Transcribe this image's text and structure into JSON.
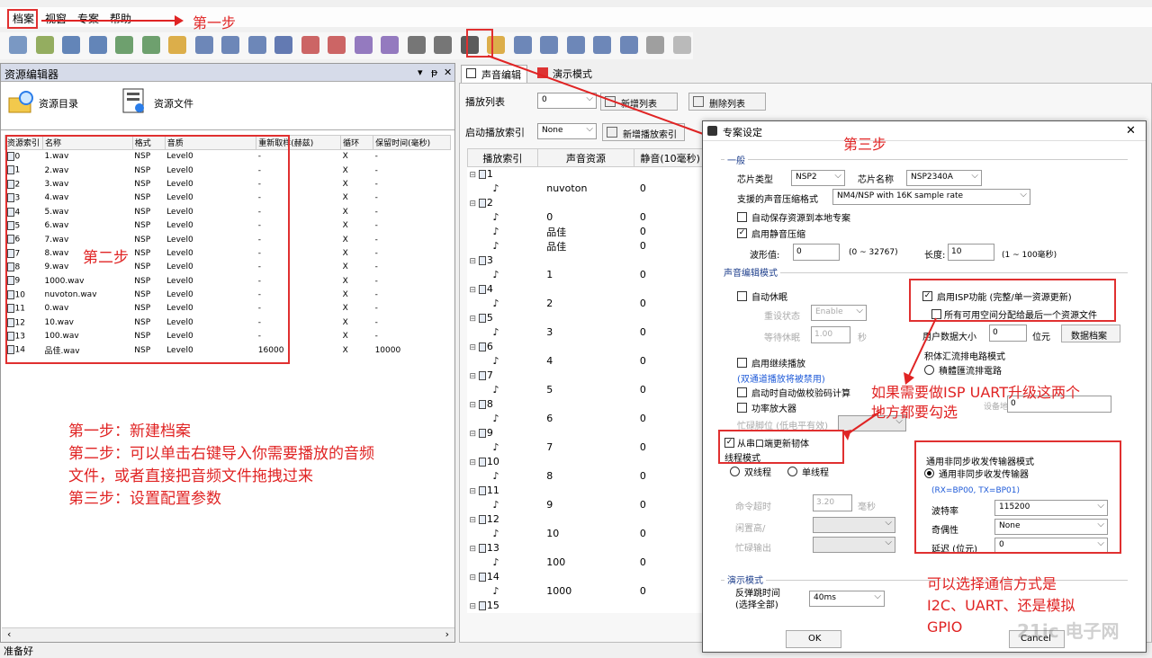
{
  "menu": [
    "档案",
    "视窗",
    "专案",
    "帮助"
  ],
  "annotations": {
    "step1": "第一步",
    "step2": "第二步",
    "step3": "第三步",
    "instructions": [
      "第一步：新建档案",
      "第二步：可以单击右键导入你需要播放的音频",
      "文件，或者直接把音频文件拖拽过来",
      "第三步：设置配置参数"
    ],
    "isp_note": [
      "如果需要做ISP UART升级这两个",
      "地方都要勾选"
    ],
    "comm_note": [
      "可以选择通信方式是",
      "I2C、UART、还是模拟",
      "GPIO"
    ],
    "color": "#e02424"
  },
  "left_panel": {
    "title": "资源编辑器",
    "controls": [
      "▾",
      "ᵽ",
      "✕"
    ],
    "tab_dir": "资源目录",
    "tab_files": "资源文件",
    "columns": [
      "资源索引",
      "名称",
      "格式",
      "音质",
      "重新取样(赫兹)",
      "循环",
      "保留时间(毫秒)"
    ],
    "rows": [
      [
        "0",
        "1.wav",
        "NSP",
        "Level0",
        "-",
        "X",
        "-"
      ],
      [
        "1",
        "2.wav",
        "NSP",
        "Level0",
        "-",
        "X",
        "-"
      ],
      [
        "2",
        "3.wav",
        "NSP",
        "Level0",
        "-",
        "X",
        "-"
      ],
      [
        "3",
        "4.wav",
        "NSP",
        "Level0",
        "-",
        "X",
        "-"
      ],
      [
        "4",
        "5.wav",
        "NSP",
        "Level0",
        "-",
        "X",
        "-"
      ],
      [
        "5",
        "6.wav",
        "NSP",
        "Level0",
        "-",
        "X",
        "-"
      ],
      [
        "6",
        "7.wav",
        "NSP",
        "Level0",
        "-",
        "X",
        "-"
      ],
      [
        "7",
        "8.wav",
        "NSP",
        "Level0",
        "-",
        "X",
        "-"
      ],
      [
        "8",
        "9.wav",
        "NSP",
        "Level0",
        "-",
        "X",
        "-"
      ],
      [
        "9",
        "1000.wav",
        "NSP",
        "Level0",
        "-",
        "X",
        "-"
      ],
      [
        "10",
        "nuvoton.wav",
        "NSP",
        "Level0",
        "-",
        "X",
        "-"
      ],
      [
        "11",
        "0.wav",
        "NSP",
        "Level0",
        "-",
        "X",
        "-"
      ],
      [
        "12",
        "10.wav",
        "NSP",
        "Level0",
        "-",
        "X",
        "-"
      ],
      [
        "13",
        "100.wav",
        "NSP",
        "Level0",
        "-",
        "X",
        "-"
      ],
      [
        "14",
        "品佳.wav",
        "NSP",
        "Level0",
        "16000",
        "X",
        "10000"
      ]
    ],
    "status": "准备好"
  },
  "right_tabs": [
    "声音编辑",
    "演示模式"
  ],
  "sound_edit": {
    "playlist_label": "播放列表",
    "playlist_value": "0",
    "new_list": "新增列表",
    "delete_list": "删除列表",
    "start_index_label": "启动播放索引",
    "start_index_value": "None",
    "new_play_index": "新增播放索引",
    "columns": [
      "播放索引",
      "声音资源",
      "静音(10毫秒)"
    ],
    "groups": [
      {
        "index": "1",
        "items": [
          [
            "nuvoton",
            "0"
          ]
        ]
      },
      {
        "index": "2",
        "items": [
          [
            "0",
            "0"
          ],
          [
            "品佳",
            "0"
          ],
          [
            "品佳",
            "0"
          ]
        ]
      },
      {
        "index": "3",
        "items": [
          [
            "1",
            "0"
          ]
        ]
      },
      {
        "index": "4",
        "items": [
          [
            "2",
            "0"
          ]
        ]
      },
      {
        "index": "5",
        "items": [
          [
            "3",
            "0"
          ]
        ]
      },
      {
        "index": "6",
        "items": [
          [
            "4",
            "0"
          ]
        ]
      },
      {
        "index": "7",
        "items": [
          [
            "5",
            "0"
          ]
        ]
      },
      {
        "index": "8",
        "items": [
          [
            "6",
            "0"
          ]
        ]
      },
      {
        "index": "9",
        "items": [
          [
            "7",
            "0"
          ]
        ]
      },
      {
        "index": "10",
        "items": [
          [
            "8",
            "0"
          ]
        ]
      },
      {
        "index": "11",
        "items": [
          [
            "9",
            "0"
          ]
        ]
      },
      {
        "index": "12",
        "items": [
          [
            "10",
            "0"
          ]
        ]
      },
      {
        "index": "13",
        "items": [
          [
            "100",
            "0"
          ]
        ]
      },
      {
        "index": "14",
        "items": [
          [
            "1000",
            "0"
          ]
        ]
      },
      {
        "index": "15",
        "items": []
      }
    ]
  },
  "dialog": {
    "title": "专案设定",
    "close": "✕",
    "general_title": "一般",
    "chip_type_label": "芯片类型",
    "chip_type": "NSP2",
    "chip_name_label": "芯片名称",
    "chip_name": "NSP2340A",
    "compress_label": "支援的声音压缩格式",
    "compress_value": "NM4/NSP with 16K sample rate",
    "auto_save": "自动保存资源到本地专案",
    "silence_compress": "启用静音压缩",
    "wave_label": "波形值:",
    "wave_value": "0",
    "wave_range": "(0 ~ 32767)",
    "length_label": "长度:",
    "length_value": "10",
    "length_range": "(1 ~ 100毫秒)",
    "mode_title": "声音编辑模式",
    "auto_sleep": "自动休眠",
    "reset_state_label": "重设状态",
    "reset_state_value": "Enable",
    "wait_sleep_label": "等待休眠",
    "wait_sleep_value": "1.00",
    "wait_sleep_unit": "秒",
    "isp_enable": "启用ISP功能 (完整/单一资源更新)",
    "isp_alloc": "所有可用空间分配给最后一个资源文件",
    "user_data_label": "用户数据大小",
    "user_data_value": "0",
    "user_data_unit": "位元",
    "data_file_btn": "数据档案",
    "continue_play": "启用继续播放",
    "continue_note": "(双通道播放将被禁用)",
    "auto_checksum": "启动时自动做校验码计算",
    "amp": "功率放大器",
    "busy_pin": "忙碌脚位 (低电平有效)",
    "bus_title": "积体汇流排电路模式",
    "bus_radio": "積體匯流排電路",
    "dev_addr_label": "设备地址: 0x",
    "dev_addr_value": "0",
    "serial_update": "从串口端更新韧体",
    "thread_mode": "线程模式",
    "dual_thread": "双线程",
    "single_thread": "单线程",
    "cmd_timeout_label": "命令超时",
    "cmd_timeout_value": "3.20",
    "cmd_timeout_unit": "毫秒",
    "idle_high_label": "闲置高/",
    "busy_output_label": "忙碌输出",
    "uart_title": "通用非同步收发传输器模式",
    "uart_radio": "通用非同步收发传输器",
    "uart_pins": "(RX=BP00, TX=BP01)",
    "baud_label": "波特率",
    "baud_value": "115200",
    "parity_label": "奇偶性",
    "parity_value": "None",
    "delay_label": "延迟 (位元)",
    "delay_value": "0",
    "demo_title": "演示模式",
    "debounce_label1": "反弹跳时间",
    "debounce_label2": "(选择全部)",
    "debounce_value": "40ms",
    "ok": "OK",
    "cancel": "Cancel"
  },
  "watermark": "21ic 电子网"
}
